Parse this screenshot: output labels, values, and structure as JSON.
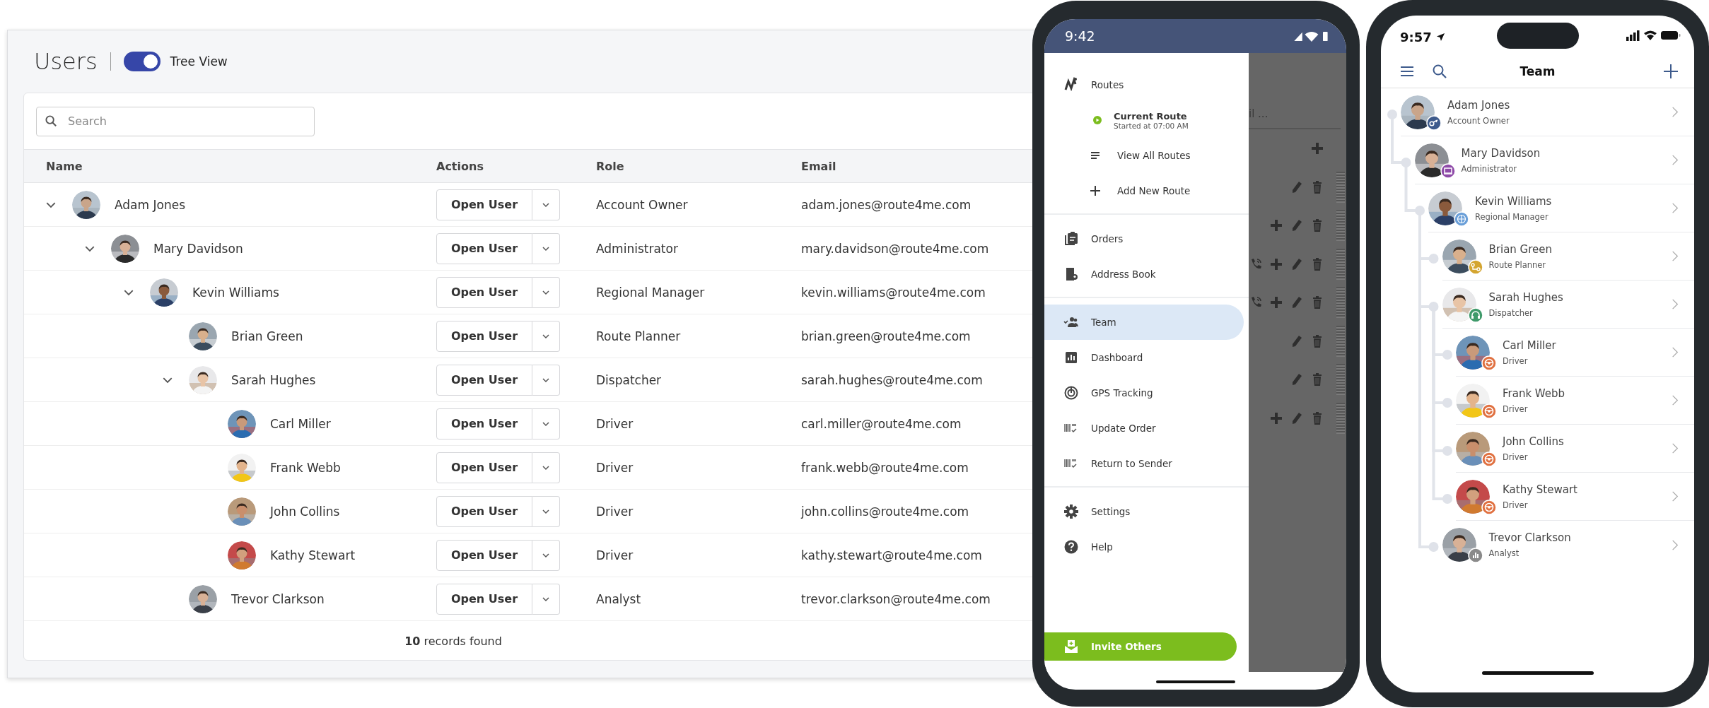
{
  "web": {
    "title": "Users",
    "tree_view": {
      "label": "Tree View",
      "on": true
    },
    "search": {
      "placeholder": "Search"
    },
    "columns": [
      "Name",
      "Actions",
      "Role",
      "Email"
    ],
    "users": [
      {
        "name": "Adam Jones",
        "action": "Open User",
        "role": "Account Owner",
        "email": "adam.jones@route4me.com",
        "expanded": true,
        "children": [
          {
            "name": "Mary Davidson",
            "action": "Open User",
            "role": "Administrator",
            "email": "mary.davidson@route4me.com",
            "expanded": true,
            "children": [
              {
                "name": "Kevin Williams",
                "action": "Open User",
                "role": "Regional Manager",
                "email": "kevin.williams@route4me.com",
                "expanded": true,
                "children": [
                  {
                    "name": "Brian Green",
                    "action": "Open User",
                    "role": "Route Planner",
                    "email": "brian.green@route4me.com"
                  },
                  {
                    "name": "Sarah Hughes",
                    "action": "Open User",
                    "role": "Dispatcher",
                    "email": "sarah.hughes@route4me.com",
                    "expanded": true,
                    "children": [
                      {
                        "name": "Carl Miller",
                        "action": "Open User",
                        "role": "Driver",
                        "email": "carl.miller@route4me.com"
                      },
                      {
                        "name": "Frank Webb",
                        "action": "Open User",
                        "role": "Driver",
                        "email": "frank.webb@route4me.com"
                      },
                      {
                        "name": "John Collins",
                        "action": "Open User",
                        "role": "Driver",
                        "email": "john.collins@route4me.com"
                      },
                      {
                        "name": "Kathy Stewart",
                        "action": "Open User",
                        "role": "Driver",
                        "email": "kathy.stewart@route4me.com"
                      }
                    ]
                  },
                  {
                    "name": "Trevor Clarkson",
                    "action": "Open User",
                    "role": "Analyst",
                    "email": "trevor.clarkson@route4me.com"
                  }
                ]
              }
            ]
          }
        ]
      }
    ],
    "footer": "**10** records found"
  },
  "drawer_phone": {
    "time": "9:42",
    "behind_text": "il ...",
    "sections": [
      [
        {
          "kind": "item",
          "label": "Routes",
          "selected": false
        },
        {
          "kind": "current",
          "label": "Current Route",
          "subtitle": "Started at 07:00 AM",
          "selected": false
        },
        {
          "kind": "sub",
          "label": "View All Routes",
          "selected": false
        },
        {
          "kind": "sub",
          "label": "Add New Route",
          "selected": false
        }
      ],
      [
        {
          "kind": "item",
          "label": "Orders",
          "selected": false
        },
        {
          "kind": "item",
          "label": "Address Book",
          "selected": false
        }
      ],
      [
        {
          "kind": "item",
          "label": "Team",
          "selected": true
        },
        {
          "kind": "item",
          "label": "Dashboard",
          "selected": false
        },
        {
          "kind": "item",
          "label": "GPS Tracking",
          "selected": false
        },
        {
          "kind": "item",
          "label": "Update Order",
          "selected": false
        },
        {
          "kind": "item",
          "label": "Return to Sender",
          "selected": false
        }
      ],
      [
        {
          "kind": "item",
          "label": "Settings",
          "selected": false
        },
        {
          "kind": "item",
          "label": "Help",
          "selected": false
        }
      ]
    ],
    "invite_button": "Invite Others"
  },
  "team_phone": {
    "time": "9:57",
    "title": "Team",
    "members": [
      {
        "name": "Adam Jones",
        "role": "Account Owner",
        "color": "#3d5a8c",
        "children": [
          {
            "name": "Mary Davidson",
            "role": "Administrator",
            "color": "#8e4aa8",
            "children": [
              {
                "name": "Kevin Williams",
                "role": "Regional Manager",
                "color": "#6a9fd8",
                "children": [
                  {
                    "name": "Brian Green",
                    "role": "Route Planner",
                    "color": "#d4a530"
                  },
                  {
                    "name": "Sarah Hughes",
                    "role": "Dispatcher",
                    "color": "#3f9a6a",
                    "children": [
                      {
                        "name": "Carl Miller",
                        "role": "Driver",
                        "color": "#e07040"
                      },
                      {
                        "name": "Frank Webb",
                        "role": "Driver",
                        "color": "#e07040"
                      },
                      {
                        "name": "John Collins",
                        "role": "Driver",
                        "color": "#e07040"
                      },
                      {
                        "name": "Kathy Stewart",
                        "role": "Driver",
                        "color": "#e07040"
                      }
                    ]
                  },
                  {
                    "name": "Trevor Clarkson",
                    "role": "Analyst",
                    "color": "#8a8a8a"
                  }
                ]
              }
            ]
          }
        ]
      }
    ]
  }
}
